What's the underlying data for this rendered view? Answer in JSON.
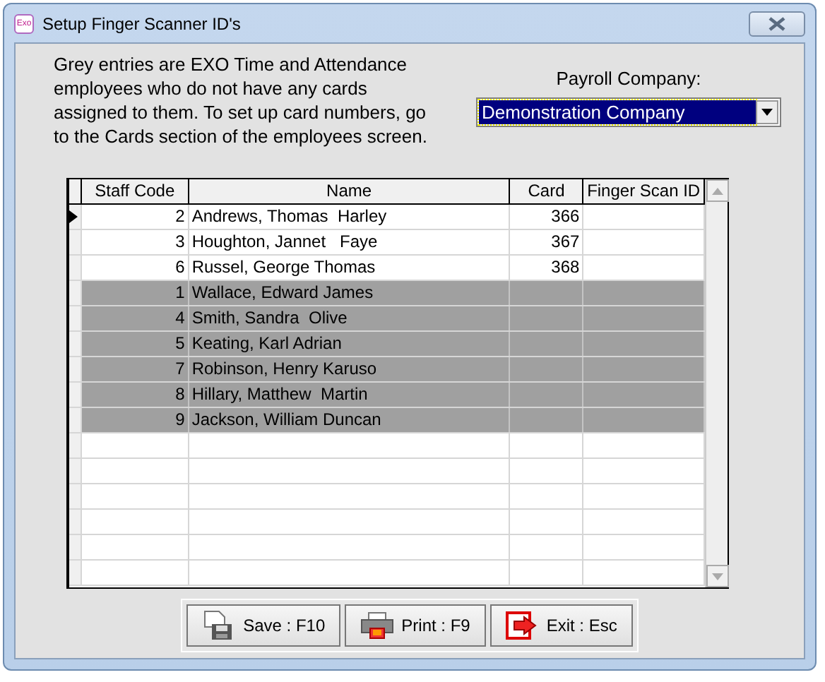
{
  "window": {
    "title": "Setup Finger Scanner ID's",
    "app_badge": "Exo"
  },
  "instructions": "Grey entries are EXO Time and Attendance employees who do not have any cards assigned to them. To set up card numbers, go to the Cards section of the employees screen.",
  "payroll_company": {
    "label": "Payroll Company:",
    "value": "Demonstration Company"
  },
  "table": {
    "columns": [
      "Staff Code",
      "Name",
      "Card",
      "Finger Scan ID"
    ],
    "rows": [
      {
        "staff_code": "2",
        "name": "Andrews, Thomas  Harley",
        "card": "366",
        "current": true,
        "greyed": false
      },
      {
        "staff_code": "3",
        "name": "Houghton, Jannet   Faye",
        "card": "367",
        "current": false,
        "greyed": false
      },
      {
        "staff_code": "6",
        "name": "Russel, George Thomas",
        "card": "368",
        "current": false,
        "greyed": false
      },
      {
        "staff_code": "1",
        "name": "Wallace, Edward James",
        "current": false,
        "greyed": true
      },
      {
        "staff_code": "4",
        "name": "Smith, Sandra  Olive",
        "current": false,
        "greyed": true
      },
      {
        "staff_code": "5",
        "name": "Keating, Karl Adrian",
        "current": false,
        "greyed": true
      },
      {
        "staff_code": "7",
        "name": "Robinson, Henry Karuso",
        "current": false,
        "greyed": true
      },
      {
        "staff_code": "8",
        "name": "Hillary, Matthew  Martin",
        "current": false,
        "greyed": true
      },
      {
        "staff_code": "9",
        "name": "Jackson, William Duncan",
        "current": false,
        "greyed": true
      }
    ]
  },
  "buttons": [
    {
      "kind": "save",
      "label": "Save : F10"
    },
    {
      "kind": "print",
      "label": "Print : F9"
    },
    {
      "kind": "exit",
      "label": "Exit : Esc"
    }
  ]
}
